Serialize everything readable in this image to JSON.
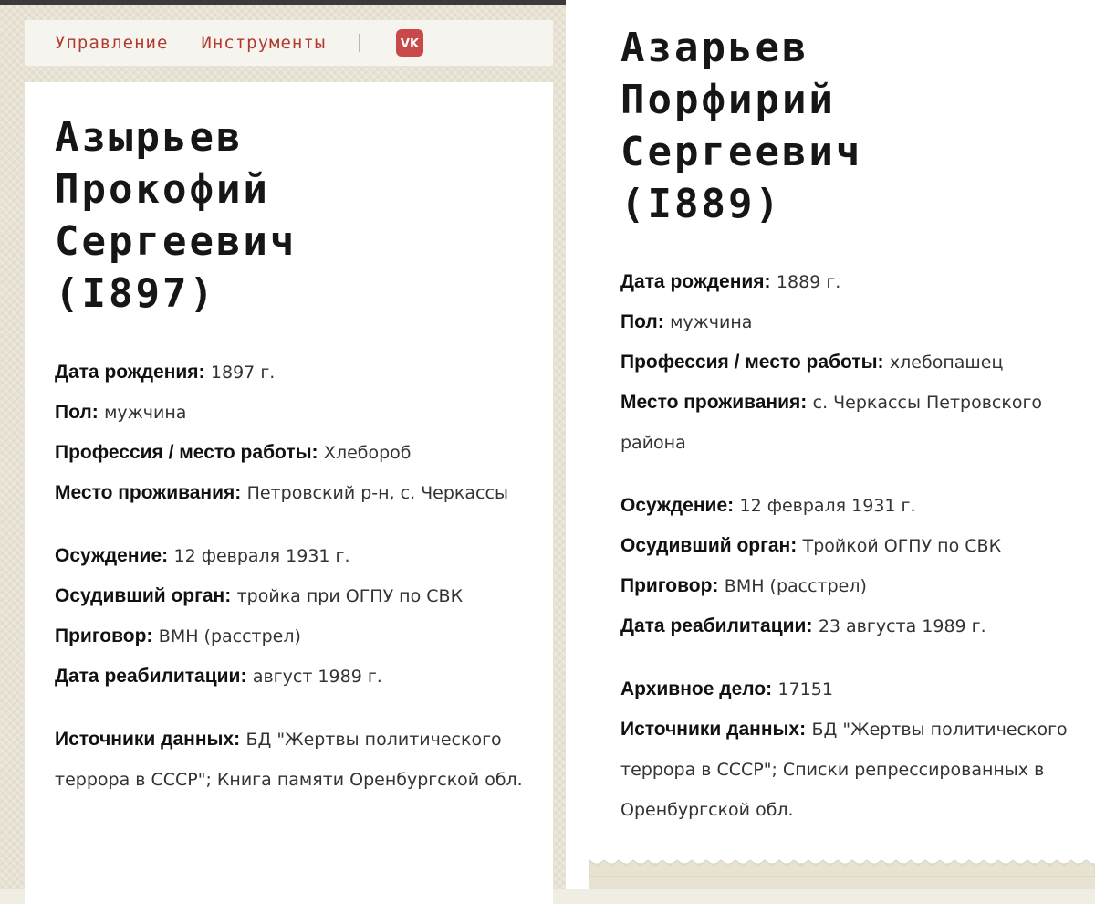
{
  "nav": {
    "items": [
      "Управление",
      "Инструменты"
    ],
    "vk_label": "VK"
  },
  "left": {
    "name_lines": [
      "Азырьев",
      "Прокофий",
      "Сергеевич",
      "(I897)"
    ],
    "groups": [
      [
        {
          "label": "Дата рождения:",
          "value": "1897 г."
        },
        {
          "label": "Пол:",
          "value": "мужчина"
        },
        {
          "label": "Профессия / место работы:",
          "value": "Хлебороб"
        },
        {
          "label": "Место проживания:",
          "value": "Петровский р-н, с. Черкассы"
        }
      ],
      [
        {
          "label": "Осуждение:",
          "value": "12 февраля 1931 г."
        },
        {
          "label": "Осудивший орган:",
          "value": "тройка при ОГПУ по СВК"
        },
        {
          "label": "Приговор:",
          "value": "ВМН (расстрел)"
        },
        {
          "label": "Дата реабилитации:",
          "value": "август 1989 г."
        }
      ],
      [
        {
          "label": "Источники данных:",
          "value": "БД \"Жертвы политического террора в СССР\"; Книга памяти Оренбургской обл."
        }
      ]
    ]
  },
  "right": {
    "name_lines": [
      "Азарьев",
      "Порфирий",
      "Сергеевич",
      "(I889)"
    ],
    "groups": [
      [
        {
          "label": "Дата рождения:",
          "value": "1889 г."
        },
        {
          "label": "Пол:",
          "value": "мужчина"
        },
        {
          "label": "Профессия / место работы:",
          "value": "хлебопашец"
        },
        {
          "label": "Место проживания:",
          "value": "с. Черкассы Петровского района"
        }
      ],
      [
        {
          "label": "Осуждение:",
          "value": "12 февраля 1931 г."
        },
        {
          "label": "Осудивший орган:",
          "value": "Тройкой ОГПУ по СВК"
        },
        {
          "label": "Приговор:",
          "value": "ВМН (расстрел)"
        },
        {
          "label": "Дата реабилитации:",
          "value": "23 августа 1989 г."
        }
      ],
      [
        {
          "label": "Архивное дело:",
          "value": "17151"
        },
        {
          "label": "Источники данных:",
          "value": "БД \"Жертвы политического террора в СССР\"; Списки репрессированных в Оренбургской обл."
        }
      ]
    ]
  },
  "colors": {
    "nav_link": "#b03a2e",
    "vk_bg": "#c9484a",
    "page_bg": "#e8e2d3"
  }
}
